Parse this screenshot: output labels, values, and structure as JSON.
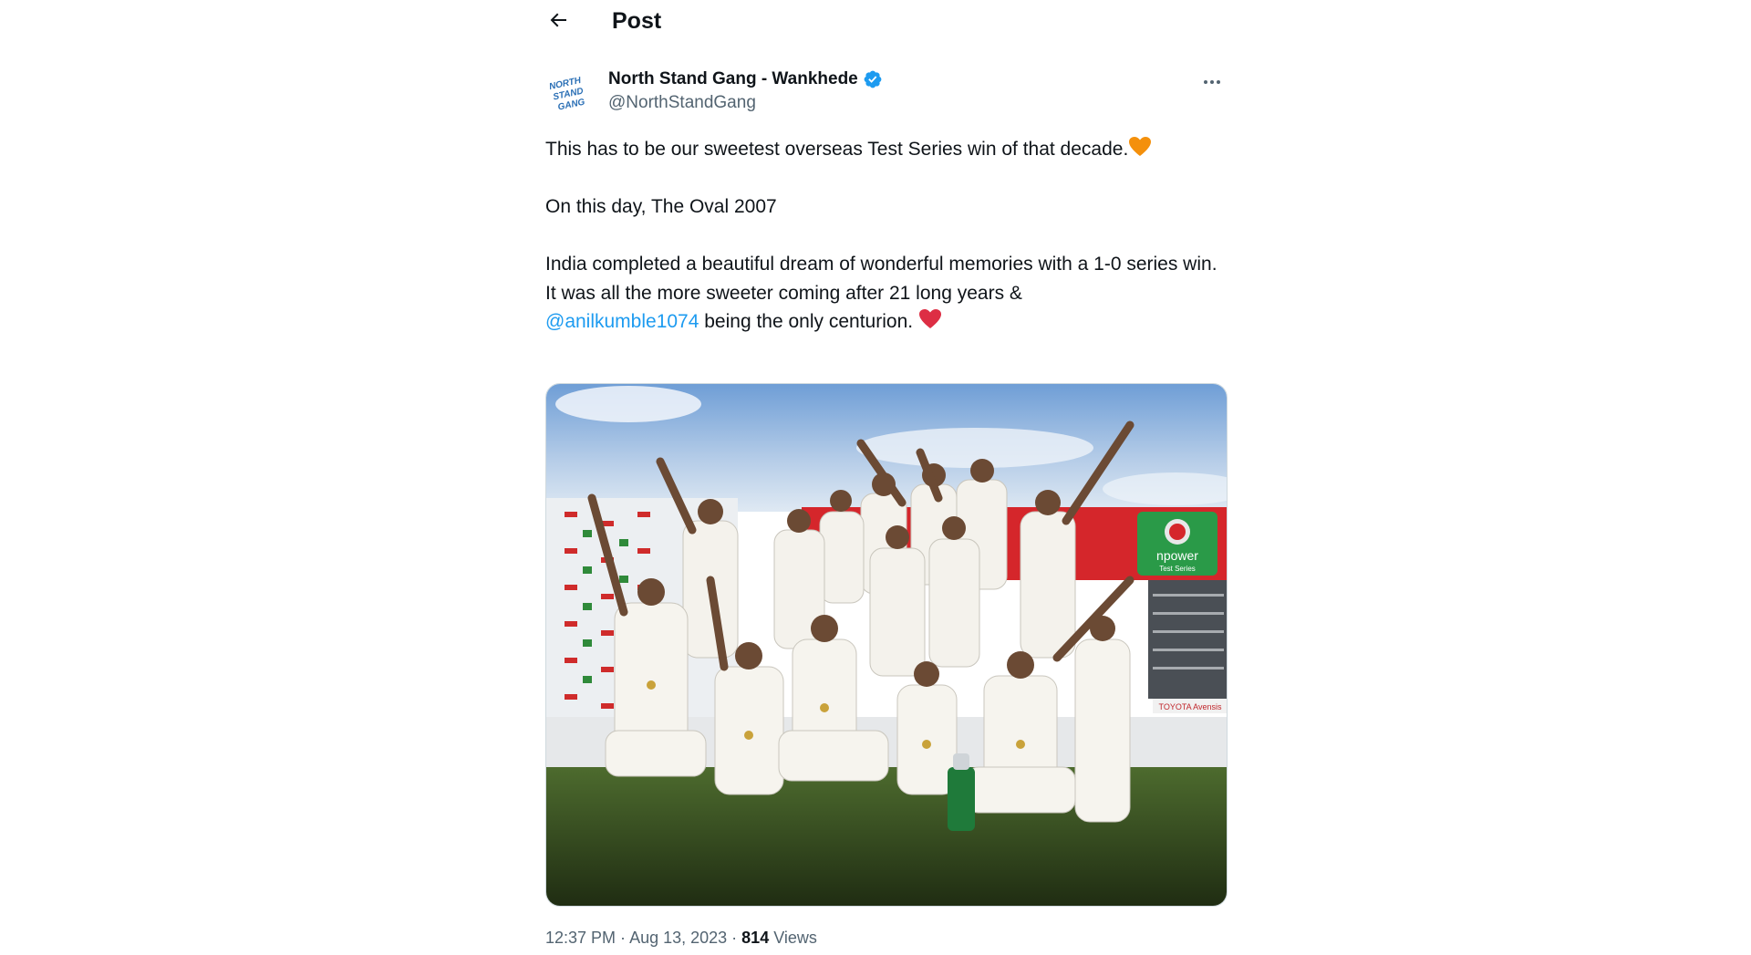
{
  "header": {
    "title": "Post"
  },
  "author": {
    "display_name": "North Stand Gang - Wankhede",
    "handle": "@NorthStandGang",
    "verified": true,
    "avatar_text": [
      "NORTH",
      "STAND",
      "GANG"
    ]
  },
  "tweet": {
    "line1": "This has to be our sweetest overseas Test Series win of that decade.",
    "line2": "On this day, The Oval 2007",
    "line3": "India completed a beautiful dream of wonderful memories with a 1-0 series win.",
    "line4": "It was all the more sweeter coming after 21 long years &",
    "mention": "@anilkumble1074",
    "line5": " being the only centurion. "
  },
  "media": {
    "banner_text": "npower",
    "banner_subtext": "Test Series",
    "board_text": "TOYOTA Avensis"
  },
  "meta": {
    "time": "12:37 PM",
    "separator": " · ",
    "date": "Aug 13, 2023",
    "views_count": "814",
    "views_label": " Views"
  },
  "colors": {
    "accent": "#1d9bf0",
    "text_primary": "#0f1419",
    "text_secondary": "#536471"
  }
}
